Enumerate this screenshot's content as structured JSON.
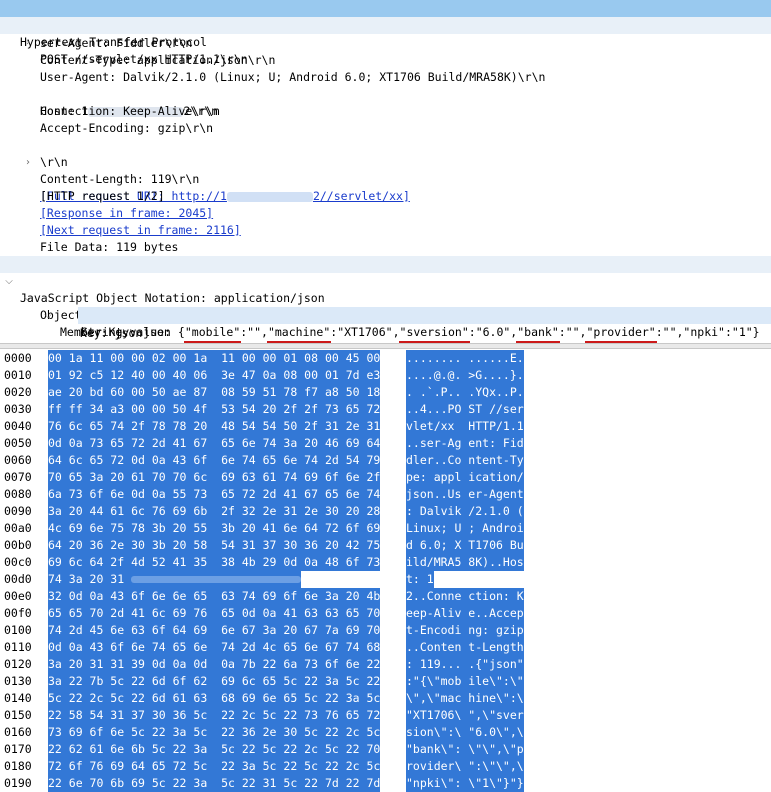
{
  "tree": {
    "http_header": "Hypertext Transfer Protocol",
    "post_line": "POST //servlet/xx HTTP/1.1\\r\\n",
    "ser_agent": "ser-Agent: Fiddler\\r\\n",
    "content_type": "Content-Type: application/json\\r\\n",
    "user_agent": "User-Agent: Dalvik/2.1.0 (Linux; U; Android 6.0; XT1706 Build/MRA58K)\\r\\n",
    "host_prefix": "Host: 1",
    "host_suffix": "2\\r\\n",
    "connection": "Connection: Keep-Alive\\r\\n",
    "accept_encoding": "Accept-Encoding: gzip\\r\\n",
    "content_length": "Content-Length: 119\\r\\n",
    "crlf": "\\r\\n",
    "full_uri_prefix": "[Full request URI: http://1",
    "full_uri_suffix": "2//servlet/xx]",
    "http_request": "[HTTP request 1/2]",
    "response_in_frame": "[Response in frame: 2045]",
    "next_request_in_frame": "[Next request in frame: 2116]",
    "file_data": "File Data: 119 bytes",
    "json_header": "JavaScript Object Notation: application/json",
    "object": "Object",
    "member_key": "Member Key: json",
    "string_value_label": "String value: {",
    "string_value_parts": [
      "\"mobile\"",
      ":\"\",",
      "\"machine\"",
      ":\"XT1706\",",
      "\"sversion\"",
      ":\"6.0\",",
      "\"bank\"",
      ":\"\",",
      "\"provider\"",
      ":\"\",\"npki\":\"1\"}"
    ],
    "key": "Key: json"
  },
  "hex_rows": [
    {
      "off": "0000",
      "hex": "00 1a 11 00 00 02 00 1a  11 00 00 01 08 00 45 00",
      "asc": "........ ......E."
    },
    {
      "off": "0010",
      "hex": "01 92 c5 12 40 00 40 06  3e 47 0a 08 00 01 7d e3",
      "asc": "....@.@. >G....}."
    },
    {
      "off": "0020",
      "hex": "ae 20 bd 60 00 50 ae 87  08 59 51 78 f7 a8 50 18",
      "asc": ". .`.P.. .YQx..P."
    },
    {
      "off": "0030",
      "hex": "ff ff 34 a3 00 00 50 4f  53 54 20 2f 2f 73 65 72",
      "asc": "..4...PO ST //ser"
    },
    {
      "off": "0040",
      "hex": "76 6c 65 74 2f 78 78 20  48 54 54 50 2f 31 2e 31",
      "asc": "vlet/xx  HTTP/1.1"
    },
    {
      "off": "0050",
      "hex": "0d 0a 73 65 72 2d 41 67  65 6e 74 3a 20 46 69 64",
      "asc": "..ser-Ag ent: Fid"
    },
    {
      "off": "0060",
      "hex": "64 6c 65 72 0d 0a 43 6f  6e 74 65 6e 74 2d 54 79",
      "asc": "dler..Co ntent-Ty"
    },
    {
      "off": "0070",
      "hex": "70 65 3a 20 61 70 70 6c  69 63 61 74 69 6f 6e 2f",
      "asc": "pe: appl ication/"
    },
    {
      "off": "0080",
      "hex": "6a 73 6f 6e 0d 0a 55 73  65 72 2d 41 67 65 6e 74",
      "asc": "json..Us er-Agent"
    },
    {
      "off": "0090",
      "hex": "3a 20 44 61 6c 76 69 6b  2f 32 2e 31 2e 30 20 28",
      "asc": ": Dalvik /2.1.0 ("
    },
    {
      "off": "00a0",
      "hex": "4c 69 6e 75 78 3b 20 55  3b 20 41 6e 64 72 6f 69",
      "asc": "Linux; U ; Androi"
    },
    {
      "off": "00b0",
      "hex": "64 20 36 2e 30 3b 20 58  54 31 37 30 36 20 42 75",
      "asc": "d 6.0; X T1706 Bu"
    },
    {
      "off": "00c0",
      "hex": "69 6c 64 2f 4d 52 41 35  38 4b 29 0d 0a 48 6f 73",
      "asc": "ild/MRA5 8K)..Hos"
    },
    {
      "off": "00d0",
      "hex": "74 3a 20 31",
      "asc": "t: 1",
      "blur": true
    },
    {
      "off": "00e0",
      "hex": "32 0d 0a 43 6f 6e 6e 65  63 74 69 6f 6e 3a 20 4b",
      "asc": "2..Conne ction: K"
    },
    {
      "off": "00f0",
      "hex": "65 65 70 2d 41 6c 69 76  65 0d 0a 41 63 63 65 70",
      "asc": "eep-Aliv e..Accep"
    },
    {
      "off": "0100",
      "hex": "74 2d 45 6e 63 6f 64 69  6e 67 3a 20 67 7a 69 70",
      "asc": "t-Encodi ng: gzip"
    },
    {
      "off": "0110",
      "hex": "0d 0a 43 6f 6e 74 65 6e  74 2d 4c 65 6e 67 74 68",
      "asc": "..Conten t-Length"
    },
    {
      "off": "0120",
      "hex": "3a 20 31 31 39 0d 0a 0d  0a 7b 22 6a 73 6f 6e 22",
      "asc": ": 119... .{\"json\""
    },
    {
      "off": "0130",
      "hex": "3a 22 7b 5c 22 6d 6f 62  69 6c 65 5c 22 3a 5c 22",
      "asc": ":\"{\\\"mob ile\\\":\\\""
    },
    {
      "off": "0140",
      "hex": "5c 22 2c 5c 22 6d 61 63  68 69 6e 65 5c 22 3a 5c",
      "asc": "\\\",\\\"mac hine\\\":\\"
    },
    {
      "off": "0150",
      "hex": "22 58 54 31 37 30 36 5c  22 2c 5c 22 73 76 65 72",
      "asc": "\"XT1706\\ \",\\\"sver"
    },
    {
      "off": "0160",
      "hex": "73 69 6f 6e 5c 22 3a 5c  22 36 2e 30 5c 22 2c 5c",
      "asc": "sion\\\":\\ \"6.0\\\",\\"
    },
    {
      "off": "0170",
      "hex": "22 62 61 6e 6b 5c 22 3a  5c 22 5c 22 2c 5c 22 70",
      "asc": "\"bank\\\": \\\"\\\",\\\"p"
    },
    {
      "off": "0180",
      "hex": "72 6f 76 69 64 65 72 5c  22 3a 5c 22 5c 22 2c 5c",
      "asc": "rovider\\ \":\\\"\\\",\\"
    },
    {
      "off": "0190",
      "hex": "22 6e 70 6b 69 5c 22 3a  5c 22 31 5c 22 7d 22 7d",
      "asc": "\"npki\\\": \\\"1\\\"}\"}"
    }
  ]
}
